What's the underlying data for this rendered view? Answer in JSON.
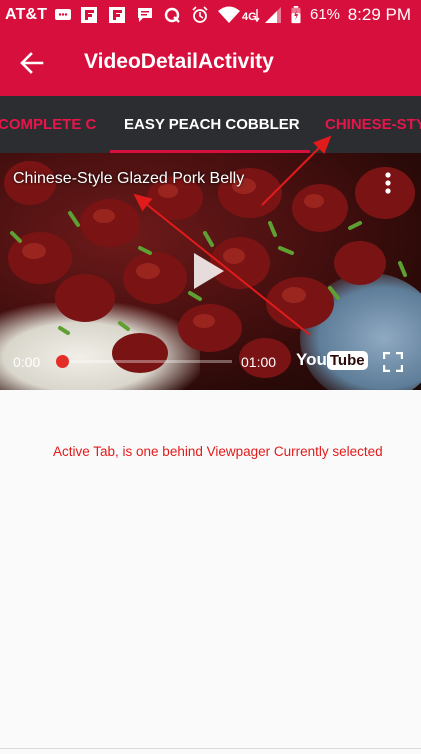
{
  "status_bar": {
    "carrier": "AT&T",
    "battery_percent": "61%",
    "time": "8:29 PM",
    "icons": [
      "message-icon",
      "flipboard-icon",
      "flipboard-icon",
      "chat-icon",
      "q-icon",
      "alarm-icon",
      "wifi-icon",
      "4g-lte-icon",
      "signal-icon",
      "battery-icon"
    ]
  },
  "app_bar": {
    "title": "VideoDetailActivity",
    "back_icon": "arrow-left-icon",
    "background": "#d70f3c"
  },
  "tabs": {
    "items": [
      "COMPLETE C",
      "EASY PEACH COBBLER",
      "CHINESE-STY"
    ],
    "selected_index": 1,
    "active_color": "#ffffff",
    "inactive_color": "#e8154a",
    "indicator_color": "#d70f3c"
  },
  "video": {
    "title": "Chinese-Style Glazed Pork Belly",
    "current_time": "0:00",
    "duration": "01:00",
    "progress": 0,
    "logo_you": "You",
    "logo_tube": "Tube",
    "icons": [
      "more-vert-icon",
      "play-icon",
      "fullscreen-icon"
    ]
  },
  "annotation": {
    "text": "Active Tab, is one behind Viewpager Currently selected",
    "color": "#e11b1b"
  }
}
